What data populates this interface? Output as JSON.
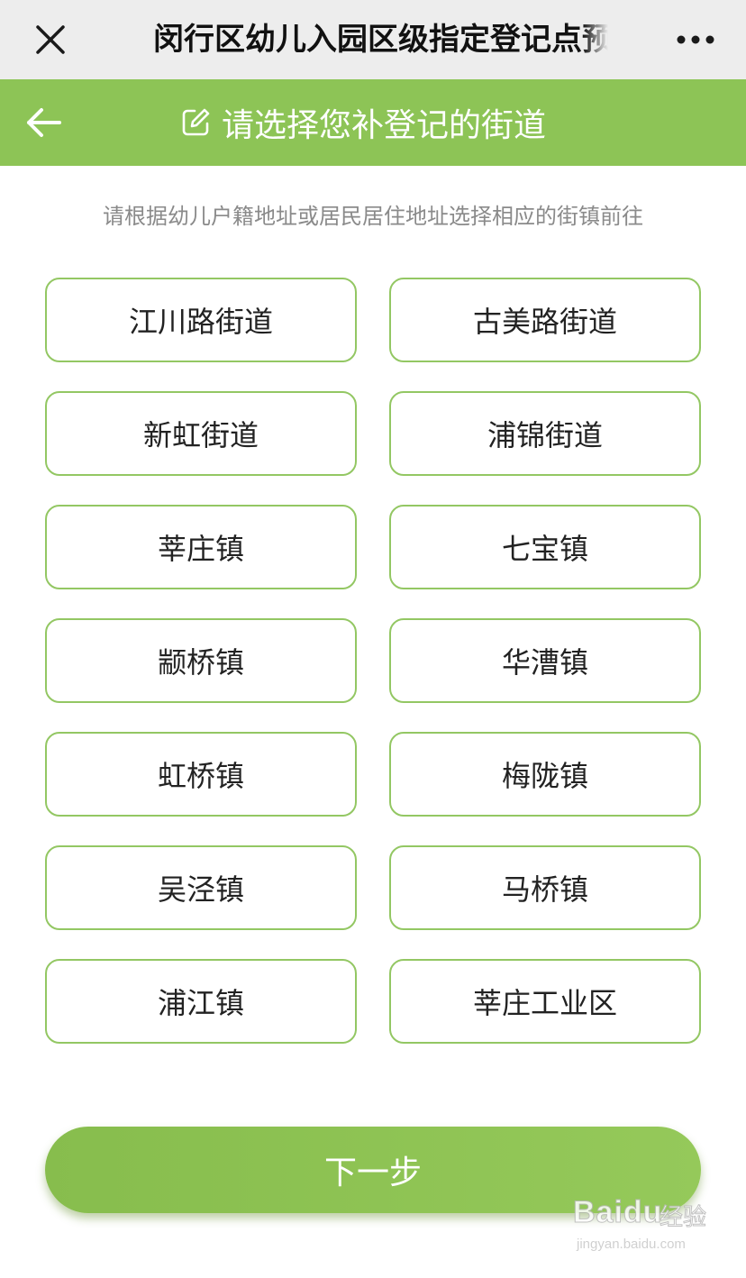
{
  "nav": {
    "title": "闵行区幼儿入园区级指定登记点预",
    "close_icon": "close-icon",
    "more_icon": "more-icon"
  },
  "header": {
    "title": "请选择您补登记的街道",
    "back_icon": "back-arrow-icon",
    "edit_icon": "edit-icon",
    "color": "#8dc456"
  },
  "hint": "请根据幼儿户籍地址或居民居住地址选择相应的街镇前往",
  "options": [
    "江川路街道",
    "古美路街道",
    "新虹街道",
    "浦锦街道",
    "莘庄镇",
    "七宝镇",
    "颛桥镇",
    "华漕镇",
    "虹桥镇",
    "梅陇镇",
    "吴泾镇",
    "马桥镇",
    "浦江镇",
    "莘庄工业区"
  ],
  "next_button": "下一步",
  "watermark": {
    "brand": "Baidu",
    "brand_cn": "经验",
    "url": "jingyan.baidu.com"
  }
}
